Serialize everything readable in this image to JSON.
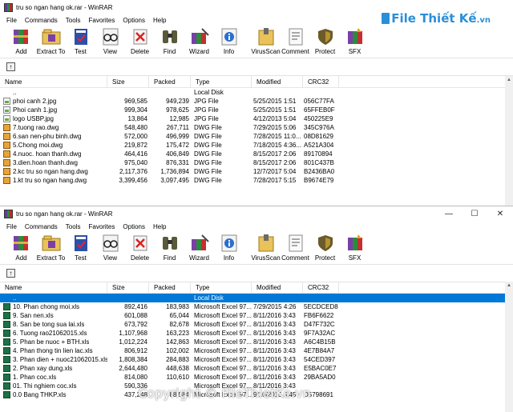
{
  "windows": [
    {
      "title": "tru so ngan hang ok.rar - WinRAR",
      "controls": {
        "minimize": "—",
        "maximize": "☐",
        "close": "✕"
      },
      "menu": [
        "File",
        "Commands",
        "Tools",
        "Favorites",
        "Options",
        "Help"
      ],
      "toolbar": [
        {
          "label": "Add",
          "icon": "add-archive-icon"
        },
        {
          "label": "Extract To",
          "icon": "extract-folder-icon"
        },
        {
          "label": "Test",
          "icon": "test-book-icon"
        },
        {
          "label": "View",
          "icon": "view-glasses-icon"
        },
        {
          "label": "Delete",
          "icon": "delete-icon"
        },
        {
          "label": "Find",
          "icon": "find-binoculars-icon"
        },
        {
          "label": "Wizard",
          "icon": "wizard-icon"
        },
        {
          "label": "Info",
          "icon": "info-icon"
        },
        {
          "label": "VirusScan",
          "icon": "virus-scan-icon"
        },
        {
          "label": "Comment",
          "icon": "comment-icon"
        },
        {
          "label": "Protect",
          "icon": "protect-shield-icon"
        },
        {
          "label": "SFX",
          "icon": "sfx-icon"
        }
      ],
      "columns": [
        "Name",
        "Size",
        "Packed",
        "Type",
        "Modified",
        "CRC32"
      ],
      "rows": [
        {
          "name": "..",
          "size": "",
          "packed": "",
          "type": "Local Disk",
          "modified": "",
          "crc": "",
          "kind": "up"
        },
        {
          "name": "phoi canh 2.jpg",
          "size": "969,585",
          "packed": "949,239",
          "type": "JPG File",
          "modified": "5/25/2015 1:51",
          "crc": "056C77FA",
          "kind": "jpg"
        },
        {
          "name": "Phoi canh 1.jpg",
          "size": "999,304",
          "packed": "978,625",
          "type": "JPG File",
          "modified": "5/25/2015 1:51",
          "crc": "65FFEB0F",
          "kind": "jpg"
        },
        {
          "name": "logo USBP.jpg",
          "size": "13,864",
          "packed": "12,985",
          "type": "JPG File",
          "modified": "4/12/2013 5:04",
          "crc": "450225E9",
          "kind": "jpg"
        },
        {
          "name": "7.tuong rao.dwg",
          "size": "548,480",
          "packed": "267,711",
          "type": "DWG File",
          "modified": "7/29/2015 5:06",
          "crc": "345C976A",
          "kind": "dwg"
        },
        {
          "name": "6.san nen-phu binh.dwg",
          "size": "572,000",
          "packed": "496,999",
          "type": "DWG File",
          "modified": "7/28/2015 11:0...",
          "crc": "08D81629",
          "kind": "dwg"
        },
        {
          "name": "5.Chong moi.dwg",
          "size": "219,872",
          "packed": "175,472",
          "type": "DWG File",
          "modified": "7/18/2015 4:36...",
          "crc": "A521A304",
          "kind": "dwg"
        },
        {
          "name": "4.nuoc. hoan thanh.dwg",
          "size": "464,416",
          "packed": "406,849",
          "type": "DWG File",
          "modified": "8/15/2017 2:06",
          "crc": "89170894",
          "kind": "dwg"
        },
        {
          "name": "3.dien.hoan thanh.dwg",
          "size": "975,040",
          "packed": "876,331",
          "type": "DWG File",
          "modified": "8/15/2017 2:06",
          "crc": "801C437B",
          "kind": "dwg"
        },
        {
          "name": "2.kc tru so ngan hang.dwg",
          "size": "2,117,376",
          "packed": "1,736,894",
          "type": "DWG File",
          "modified": "12/7/2017 5:04",
          "crc": "B2436BA0",
          "kind": "dwg"
        },
        {
          "name": "1.kt tru so ngan hang.dwg",
          "size": "3,399,456",
          "packed": "3,097,495",
          "type": "DWG File",
          "modified": "7/28/2017 5:15",
          "crc": "B9674E79",
          "kind": "dwg"
        }
      ]
    },
    {
      "title": "tru so ngan hang ok.rar - WinRAR",
      "controls": {
        "minimize": "—",
        "maximize": "☐",
        "close": "✕"
      },
      "menu": [
        "File",
        "Commands",
        "Tools",
        "Favorites",
        "Options",
        "Help"
      ],
      "toolbar": [
        {
          "label": "Add",
          "icon": "add-archive-icon"
        },
        {
          "label": "Extract To",
          "icon": "extract-folder-icon"
        },
        {
          "label": "Test",
          "icon": "test-book-icon"
        },
        {
          "label": "View",
          "icon": "view-glasses-icon"
        },
        {
          "label": "Delete",
          "icon": "delete-icon"
        },
        {
          "label": "Find",
          "icon": "find-binoculars-icon"
        },
        {
          "label": "Wizard",
          "icon": "wizard-icon"
        },
        {
          "label": "Info",
          "icon": "info-icon"
        },
        {
          "label": "VirusScan",
          "icon": "virus-scan-icon"
        },
        {
          "label": "Comment",
          "icon": "comment-icon"
        },
        {
          "label": "Protect",
          "icon": "protect-shield-icon"
        },
        {
          "label": "SFX",
          "icon": "sfx-icon"
        }
      ],
      "columns": [
        "Name",
        "Size",
        "Packed",
        "Type",
        "Modified",
        "CRC32"
      ],
      "rows": [
        {
          "name": "..",
          "size": "",
          "packed": "",
          "type": "Local Disk",
          "modified": "",
          "crc": "",
          "kind": "up",
          "selected": true
        },
        {
          "name": "10. Phan chong moi.xls",
          "size": "892,416",
          "packed": "183,983",
          "type": "Microsoft Excel 97...",
          "modified": "7/29/2015 4:26",
          "crc": "5ECDCED8",
          "kind": "xls"
        },
        {
          "name": "9. San nen.xls",
          "size": "601,088",
          "packed": "65,044",
          "type": "Microsoft Excel 97...",
          "modified": "8/11/2016 3:43",
          "crc": "FB6F6622",
          "kind": "xls"
        },
        {
          "name": "8. San be tong sua lai.xls",
          "size": "673,792",
          "packed": "82,678",
          "type": "Microsoft Excel 97...",
          "modified": "8/11/2016 3:43",
          "crc": "D47F732C",
          "kind": "xls"
        },
        {
          "name": "6. Tuong rao21062015.xls",
          "size": "1,107,968",
          "packed": "163,223",
          "type": "Microsoft Excel 97...",
          "modified": "8/11/2016 3:43",
          "crc": "9F7A32AC",
          "kind": "xls"
        },
        {
          "name": "5. Phan be nuoc + BTH.xls",
          "size": "1,012,224",
          "packed": "142,863",
          "type": "Microsoft Excel 97...",
          "modified": "8/11/2016 3:43",
          "crc": "A6C4B15B",
          "kind": "xls"
        },
        {
          "name": "4. Phan thong tin lien lac.xls",
          "size": "806,912",
          "packed": "102,002",
          "type": "Microsoft Excel 97...",
          "modified": "8/11/2016 3:43",
          "crc": "4E7B84A7",
          "kind": "xls"
        },
        {
          "name": "3. Phan dien + nuoc21062015.xls",
          "size": "1,808,384",
          "packed": "284,883",
          "type": "Microsoft Excel 97...",
          "modified": "8/11/2016 3:43",
          "crc": "54CED397",
          "kind": "xls"
        },
        {
          "name": "2. Phan xay dung.xls",
          "size": "2,644,480",
          "packed": "448,638",
          "type": "Microsoft Excel 97...",
          "modified": "8/11/2016 3:43",
          "crc": "E5BAC0E7",
          "kind": "xls"
        },
        {
          "name": "1. Phan coc.xls",
          "size": "814,080",
          "packed": "110,610",
          "type": "Microsoft Excel 97...",
          "modified": "8/11/2016 3:43",
          "crc": "29BA5AD0",
          "kind": "xls"
        },
        {
          "name": "01. Thi nghiem coc.xls",
          "size": "590,336",
          "packed": "",
          "type": "Microsoft Excel 97...",
          "modified": "8/11/2016 3:43",
          "crc": "",
          "kind": "xls"
        },
        {
          "name": "0.0 Bang THKP.xls",
          "size": "437,248",
          "packed": "88,584",
          "type": "Microsoft Excel 97...",
          "modified": "9/10/2015 3:45",
          "crc": "D5798691",
          "kind": "xls"
        }
      ]
    }
  ],
  "logo": {
    "brand": "File",
    "rest": "Thiết Kế",
    "tld": ".vn"
  },
  "watermark": "Copyright © FileThietKe.vn",
  "colors": {
    "selection": "#0078d7",
    "logo": "#2a8fd8"
  }
}
